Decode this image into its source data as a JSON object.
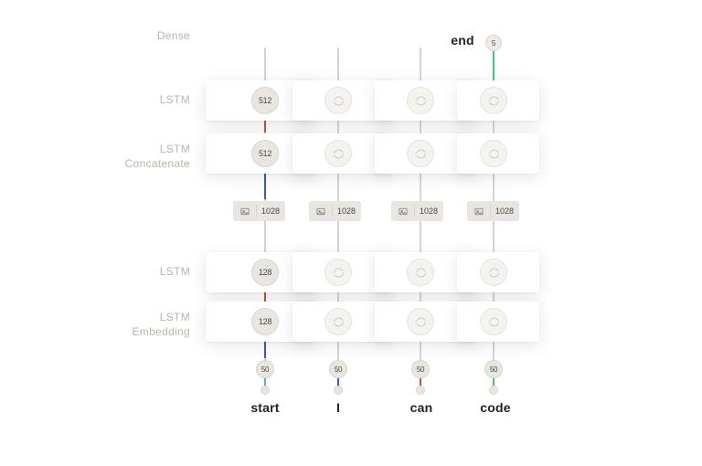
{
  "row_labels": {
    "dense": "Dense",
    "lstm3": "LSTM",
    "lstm2": "LSTM",
    "concat": "Concatenate",
    "lstm1": "LSTM",
    "lstm0": "LSTM",
    "embedding": "Embedding"
  },
  "units": {
    "lstm_upper": "512",
    "lstm_upper2": "512",
    "concat": "1028",
    "lstm_lower": "128",
    "lstm_lower2": "128",
    "embed": "50",
    "output": "5"
  },
  "words": {
    "end": "end",
    "start": "start",
    "i": "I",
    "can": "can",
    "code": "code"
  },
  "icons": {
    "trash": "trash-icon",
    "refresh": "refresh-icon",
    "image": "image-icon"
  },
  "colors": {
    "blue": "#3a54d6",
    "green": "#3fc77a",
    "red": "#d04a4a",
    "grey": "#bcb8b1",
    "light": "#d9d5ce"
  }
}
